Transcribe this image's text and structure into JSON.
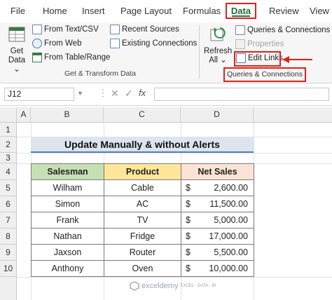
{
  "ribbon": {
    "tabs": [
      "File",
      "Home",
      "Insert",
      "Page Layout",
      "Formulas",
      "Data",
      "Review",
      "View"
    ],
    "active_tab": "Data",
    "get_data": {
      "line1": "Get",
      "line2": "Data ⌄"
    },
    "get_transform": {
      "from_text_csv": "From Text/CSV",
      "from_web": "From Web",
      "from_table_range": "From Table/Range",
      "recent_sources": "Recent Sources",
      "existing_connections": "Existing Connections",
      "group_label": "Get & Transform Data"
    },
    "refresh": {
      "line1": "Refresh",
      "line2": "All ⌄"
    },
    "queries": {
      "queries_connections": "Queries & Connections",
      "properties": "Properties",
      "edit_links": "Edit Links",
      "group_label": "Queries & Connections"
    },
    "accent_color": "#217346",
    "highlight_color": "#e0201a"
  },
  "formula_bar": {
    "name_box": "J12",
    "fx": "fx",
    "formula": ""
  },
  "grid": {
    "columns": [
      "A",
      "B",
      "C",
      "D"
    ],
    "rows": [
      "1",
      "2",
      "3",
      "4",
      "5",
      "6",
      "7",
      "8",
      "9",
      "10"
    ]
  },
  "sheet": {
    "title": "Update Manually & without Alerts",
    "headers": {
      "salesman": "Salesman",
      "product": "Product",
      "net_sales": "Net Sales"
    },
    "header_colors": {
      "salesman": "#c6e0b4",
      "product": "#ffe699",
      "net_sales": "#fbe4d5"
    },
    "currency": "$",
    "rows": [
      {
        "salesman": "Wilham",
        "product": "Cable",
        "net_sales": "2,600.00"
      },
      {
        "salesman": "Simon",
        "product": "AC",
        "net_sales": "11,500.00"
      },
      {
        "salesman": "Frank",
        "product": "TV",
        "net_sales": "5,000.00"
      },
      {
        "salesman": "Nathan",
        "product": "Fridge",
        "net_sales": "17,000.00"
      },
      {
        "salesman": "Jaxson",
        "product": "Router",
        "net_sales": "5,500.00"
      },
      {
        "salesman": "Anthony",
        "product": "Oven",
        "net_sales": "10,000.00"
      }
    ]
  },
  "watermark": {
    "brand": "exceldemy",
    "tagline": "EXCEL · DATA · BI"
  }
}
